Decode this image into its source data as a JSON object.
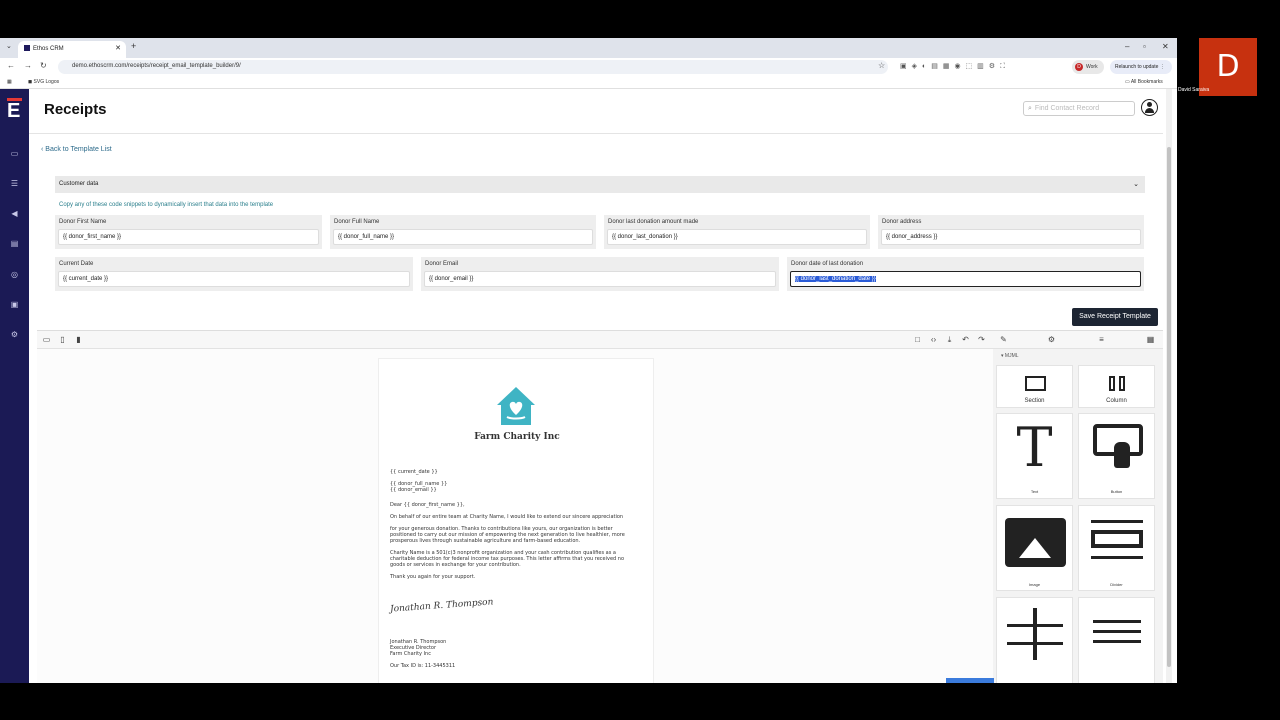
{
  "browser": {
    "tab_title": "Ethos CRM",
    "url": "demo.ethoscrm.com/receipts/receipt_email_template_builder/9/",
    "bookmark": "SVG Logos",
    "all_bookmarks": "All Bookmarks",
    "profile_label": "Work",
    "profile_initial": "D",
    "relaunch": "Relaunch to update"
  },
  "page": {
    "title": "Receipts",
    "search_placeholder": "Find Contact Record",
    "back_link": "Back to Template List",
    "accordion_title": "Customer data",
    "hint": "Copy any of these code snippets to dynamically insert that data into the template",
    "save_button": "Save Receipt Template"
  },
  "fields": [
    {
      "label": "Donor First Name",
      "value": "{{ donor_first_name }}"
    },
    {
      "label": "Donor Full Name",
      "value": "{{ donor_full_name }}"
    },
    {
      "label": "Donor last donation amount made",
      "value": "{{ donor_last_donation }}"
    },
    {
      "label": "Donor address",
      "value": "{{ donor_address }}"
    },
    {
      "label": "Current Date",
      "value": "{{ current_date }}"
    },
    {
      "label": "Donor Email",
      "value": "{{ donor_email }}"
    },
    {
      "label": "Donor date of last donation",
      "value": "{{ donor_last_donation_date }}"
    }
  ],
  "letter": {
    "org_name": "Farm Charity Inc",
    "date": "{{ current_date }}",
    "name": "{{ donor_full_name }}",
    "email": "{{ donor_email }}",
    "greeting": "Dear {{ donor_first_name }},",
    "p1": "On behalf of our entire team at Charity Name, I would like to extend our sincere appreciation",
    "p2a": "for your generous donation. Thanks to contributions like yours, our organization is better",
    "p2b": "positioned to carry out our mission of empowering the next generation to live healthier, more",
    "p2c": "prosperous lives through sustainable agriculture and farm-based education.",
    "p3a": "Charity Name is a 501(c)3 nonprofit organization and your cash contribution qualifies as a",
    "p3b": "charitable deduction for federal income tax purposes. This letter affirms that you received no",
    "p3c": "goods or services in exchange for your contribution.",
    "p4": "Thank you again for your support.",
    "signature": "Jonathan R. Thompson",
    "signer": "Jonathan R. Thompson",
    "signer_title": "Executive Director",
    "signer_org": "Farm Charity Inc",
    "tax_id": "Our Tax ID is: 11-3445311"
  },
  "blocks": {
    "group": "MJML",
    "section": "Section",
    "column": "Column",
    "text": "Text",
    "button": "Button",
    "image": "Image",
    "divider": "Divider"
  },
  "video": {
    "initial": "D",
    "name": "David Saraiva"
  },
  "colors": {
    "nav": "#1b1a55",
    "accent": "#3fb4c4",
    "save": "#1d2533"
  }
}
